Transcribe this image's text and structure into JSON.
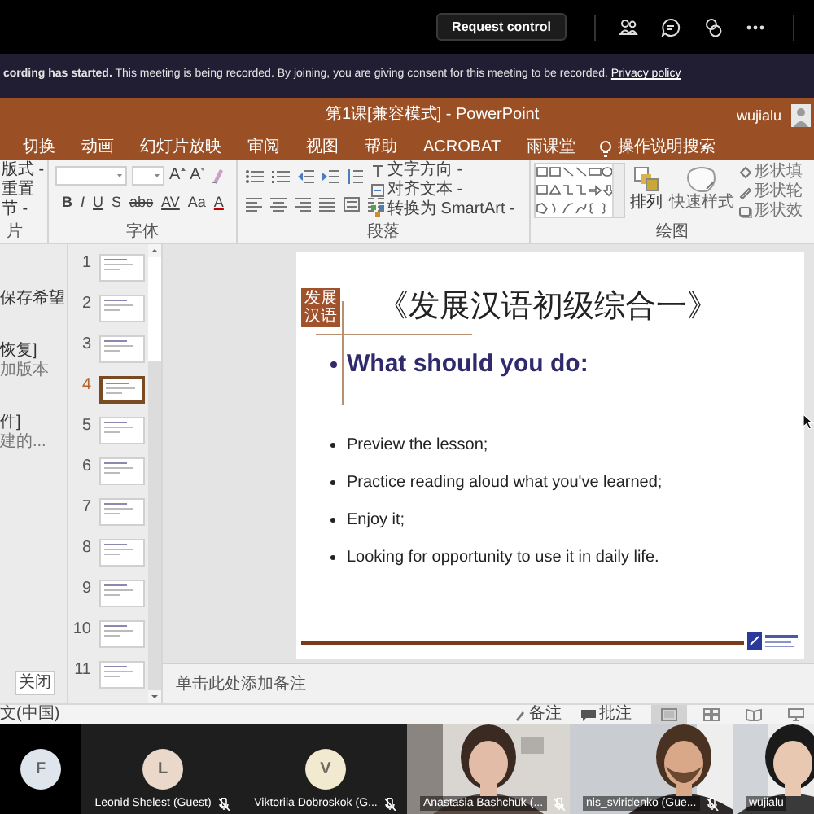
{
  "top_bar": {
    "request_control": "Request control"
  },
  "banner": {
    "text": "**cording has started.**  This meeting is being recorded. By joining, you are giving consent for this meeting to be recorded.",
    "link": "Privacy policy"
  },
  "powerpoint": {
    "title": "第1课[兼容模式] - PowerPoint",
    "user": "wujialu",
    "tabs": [
      {
        "label": "切换",
        "selected": false
      },
      {
        "label": "动画",
        "selected": false
      },
      {
        "label": "幻灯片放映",
        "selected": false
      },
      {
        "label": "审阅",
        "selected": false
      },
      {
        "label": "视图",
        "selected": false
      },
      {
        "label": "帮助",
        "selected": false
      },
      {
        "label": "ACROBAT",
        "selected": false
      },
      {
        "label": "雨课堂",
        "selected": false
      }
    ],
    "tell_me": "操作说明搜索",
    "ribbon": {
      "slides_group": {
        "commands": [
          "版式 -",
          "重置",
          "节 -"
        ],
        "label": "片"
      },
      "font_group": {
        "size_buttons": [
          "A",
          "A"
        ],
        "format_buttons": [
          "B",
          "I",
          "U",
          "S",
          "abc",
          "AV",
          "Aa",
          "A"
        ],
        "label": "字体"
      },
      "paragraph_group": {
        "commands": [
          "文字方向 -",
          "对齐文本 -",
          "转换为 SmartArt -"
        ],
        "label": "段落"
      },
      "drawing_group": {
        "arrange": "排列",
        "quick_styles": "快速样式",
        "commands": [
          "形状填",
          "形状轮",
          "形状效"
        ],
        "label": "绘图"
      }
    },
    "backstage_panel": {
      "lines": [
        {
          "text": "保存希望",
          "kind": "title"
        },
        {
          "text": "恢复]",
          "kind": "title"
        },
        {
          "text": "加版本",
          "kind": "detail"
        },
        {
          "text": "件]",
          "kind": "title"
        },
        {
          "text": "建的...",
          "kind": "detail"
        }
      ],
      "close": "关闭"
    },
    "thumbnails": [
      {
        "number": "1",
        "selected": false
      },
      {
        "number": "2",
        "selected": false
      },
      {
        "number": "3",
        "selected": false
      },
      {
        "number": "4",
        "selected": true
      },
      {
        "number": "5",
        "selected": false
      },
      {
        "number": "6",
        "selected": false
      },
      {
        "number": "7",
        "selected": false
      },
      {
        "number": "8",
        "selected": false
      },
      {
        "number": "9",
        "selected": false
      },
      {
        "number": "10",
        "selected": false
      },
      {
        "number": "11",
        "selected": false
      }
    ],
    "slide": {
      "logo": "发展汉语",
      "title": "《发展汉语初级综合一》",
      "heading": "What should you do:",
      "bullets": [
        "Preview the lesson;",
        "Practice reading aloud what you've learned;",
        "Enjoy it;",
        "Looking for opportunity to use it in daily life."
      ]
    },
    "notes_placeholder": "单击此处添加备注",
    "status_bar": {
      "language": "文(中国)",
      "notes": "备注",
      "comments": "批注",
      "views": [
        {
          "kind": "normal",
          "selected": true
        },
        {
          "kind": "sorter",
          "selected": false
        },
        {
          "kind": "reading",
          "selected": false
        },
        {
          "kind": "slideshow",
          "selected": false
        }
      ]
    }
  },
  "participants": [
    {
      "kind": "avatar",
      "initial": "F",
      "color": "#dfe5ec",
      "muted": false
    },
    {
      "kind": "avatar",
      "initial": "L",
      "name": "Leonid Shelest (Guest)",
      "color": "#ead9cb",
      "muted": true
    },
    {
      "kind": "avatar",
      "initial": "V",
      "name": "Viktoriia Dobroskok (G...",
      "color": "#f2ead0",
      "muted": true
    },
    {
      "kind": "video",
      "name": "Anastasia Bashchuk (...",
      "muted": true
    },
    {
      "kind": "video",
      "name": "nis_sviridenko (Gue...",
      "muted": true
    },
    {
      "kind": "video",
      "name": "wujialu",
      "muted": false
    }
  ]
}
